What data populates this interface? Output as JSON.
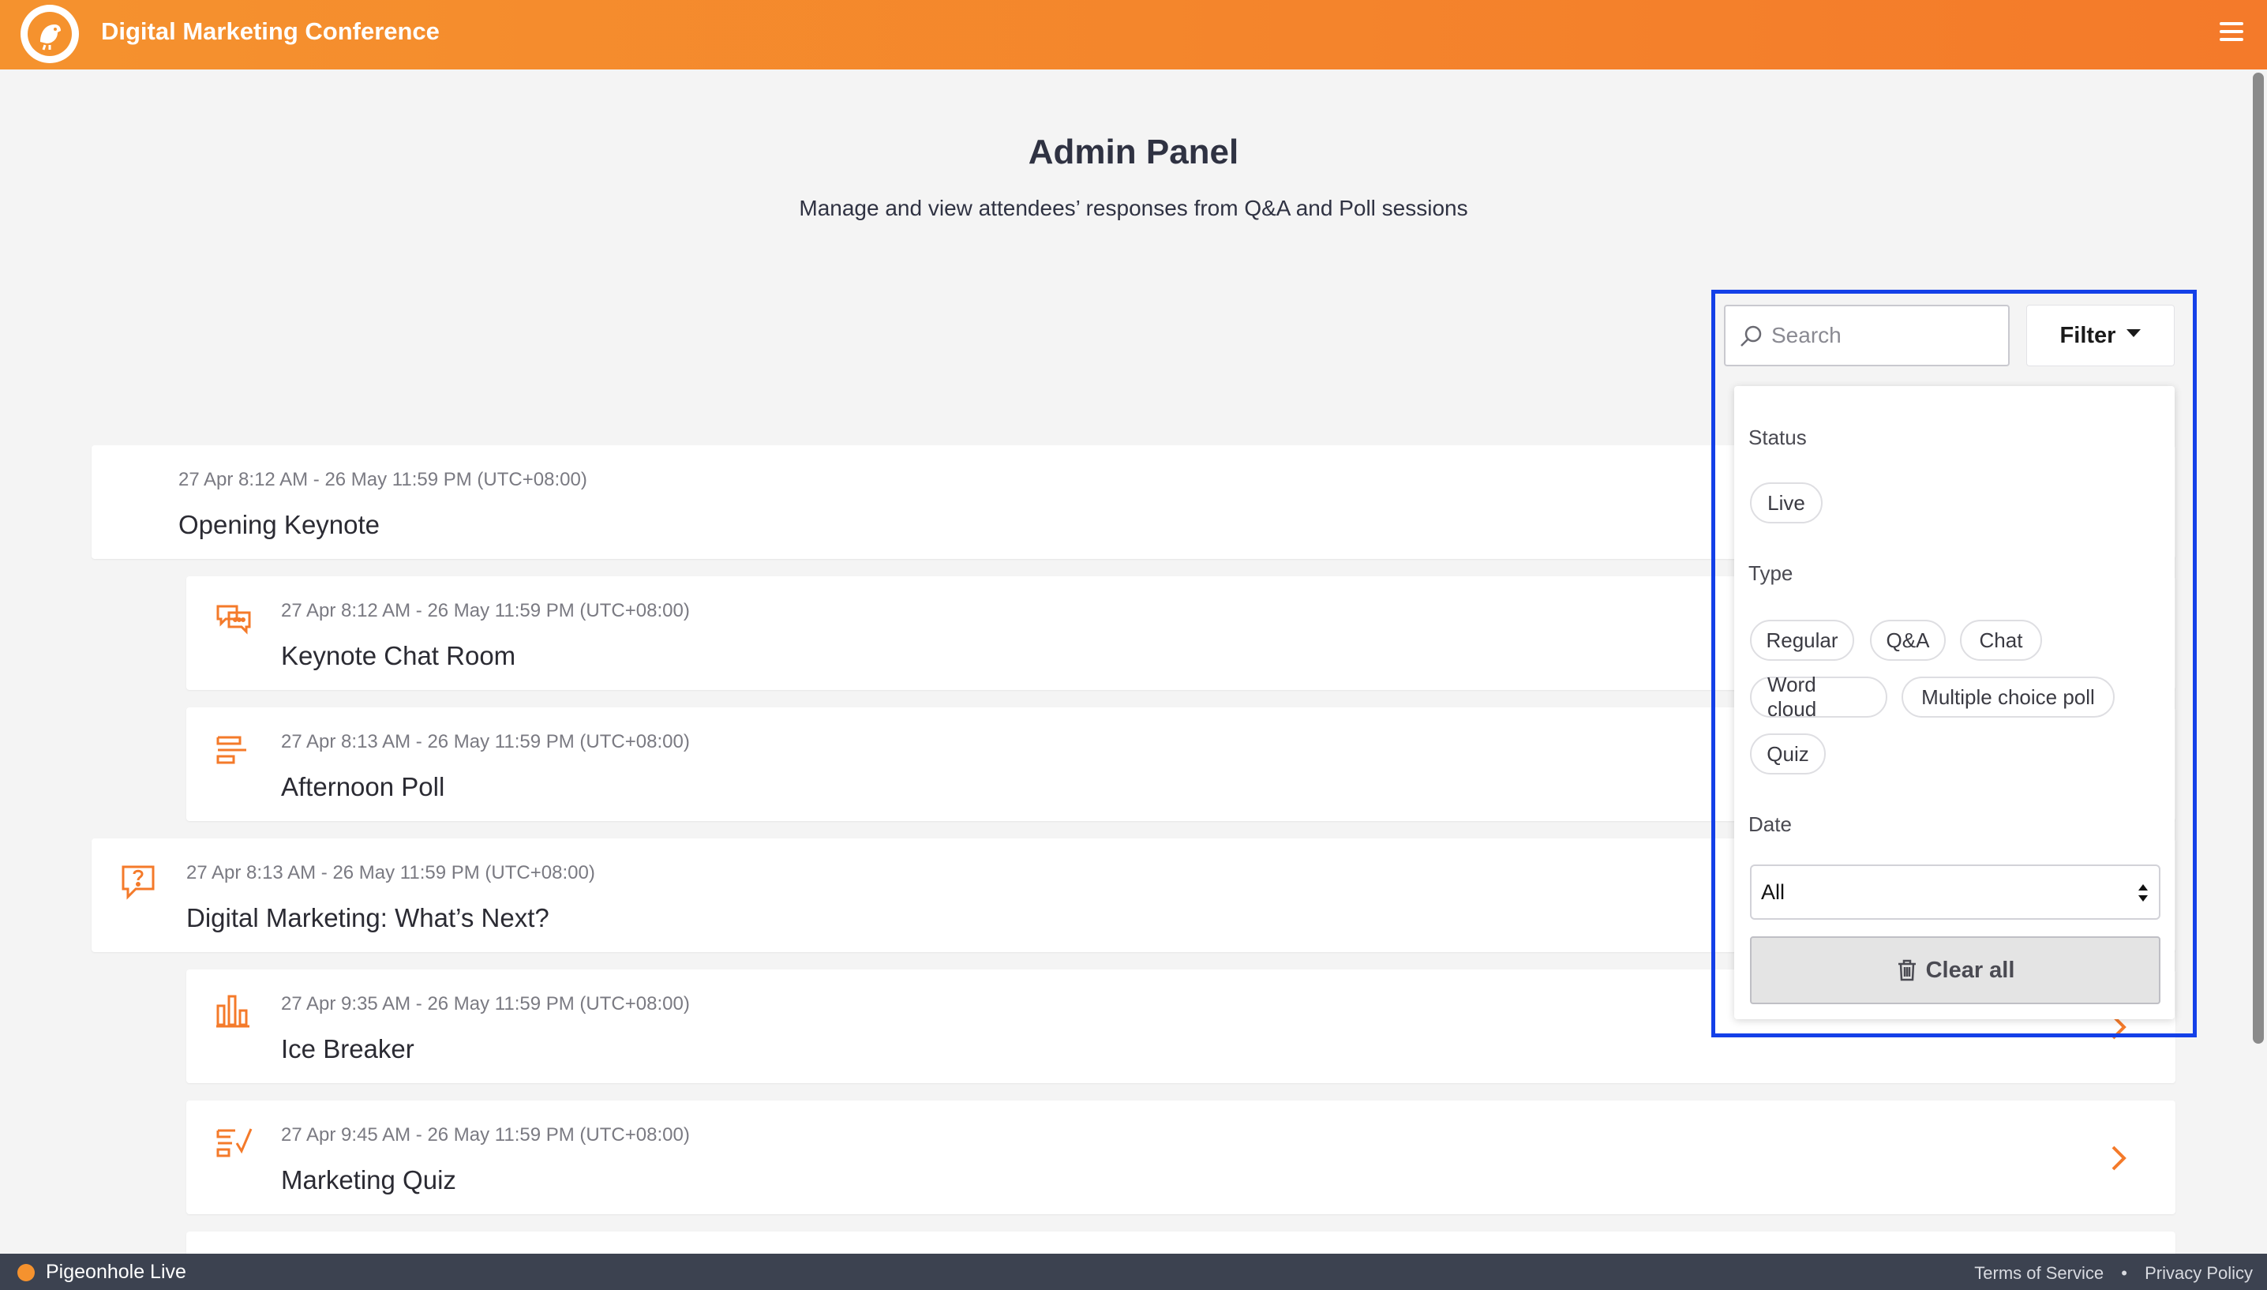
{
  "header": {
    "title": "Digital Marketing Conference",
    "logo_icon": "pigeon-logo",
    "menu_icon": "hamburger-icon"
  },
  "main": {
    "title": "Admin Panel",
    "subtitle": "Manage and view attendees’ responses from Q&A and Poll sessions"
  },
  "search": {
    "placeholder": "Search"
  },
  "filter": {
    "button_label": "Filter",
    "status_label": "Status",
    "status_options": [
      "Live"
    ],
    "type_label": "Type",
    "type_options": [
      "Regular",
      "Q&A",
      "Chat",
      "Word cloud",
      "Multiple choice poll",
      "Quiz"
    ],
    "date_label": "Date",
    "date_value": "All",
    "clear_label": "Clear all"
  },
  "sessions": [
    {
      "date": "27 Apr 8:12 AM - 26 May 11:59 PM (UTC+08:00)",
      "name": "Opening Keynote",
      "icon": "none"
    },
    {
      "date": "27 Apr 8:12 AM - 26 May 11:59 PM (UTC+08:00)",
      "name": "Keynote Chat Room",
      "icon": "chat-icon"
    },
    {
      "date": "27 Apr 8:13 AM - 26 May 11:59 PM (UTC+08:00)",
      "name": "Afternoon Poll",
      "icon": "poll-icon"
    },
    {
      "date": "27 Apr 8:13 AM - 26 May 11:59 PM (UTC+08:00)",
      "name": "Digital Marketing: What’s Next?",
      "icon": "qa-icon"
    },
    {
      "date": "27 Apr 9:35 AM - 26 May 11:59 PM (UTC+08:00)",
      "name": "Ice Breaker",
      "icon": "bar-chart-icon"
    },
    {
      "date": "27 Apr 9:45 AM - 26 May 11:59 PM (UTC+08:00)",
      "name": "Marketing Quiz",
      "icon": "quiz-icon"
    }
  ],
  "footer": {
    "brand": "Pigeonhole Live",
    "terms": "Terms of Service",
    "separator": "•",
    "privacy": "Privacy Policy"
  },
  "colors": {
    "accent": "#f47a2a",
    "highlight": "#1440e8",
    "footer_bg": "#3c4250"
  }
}
